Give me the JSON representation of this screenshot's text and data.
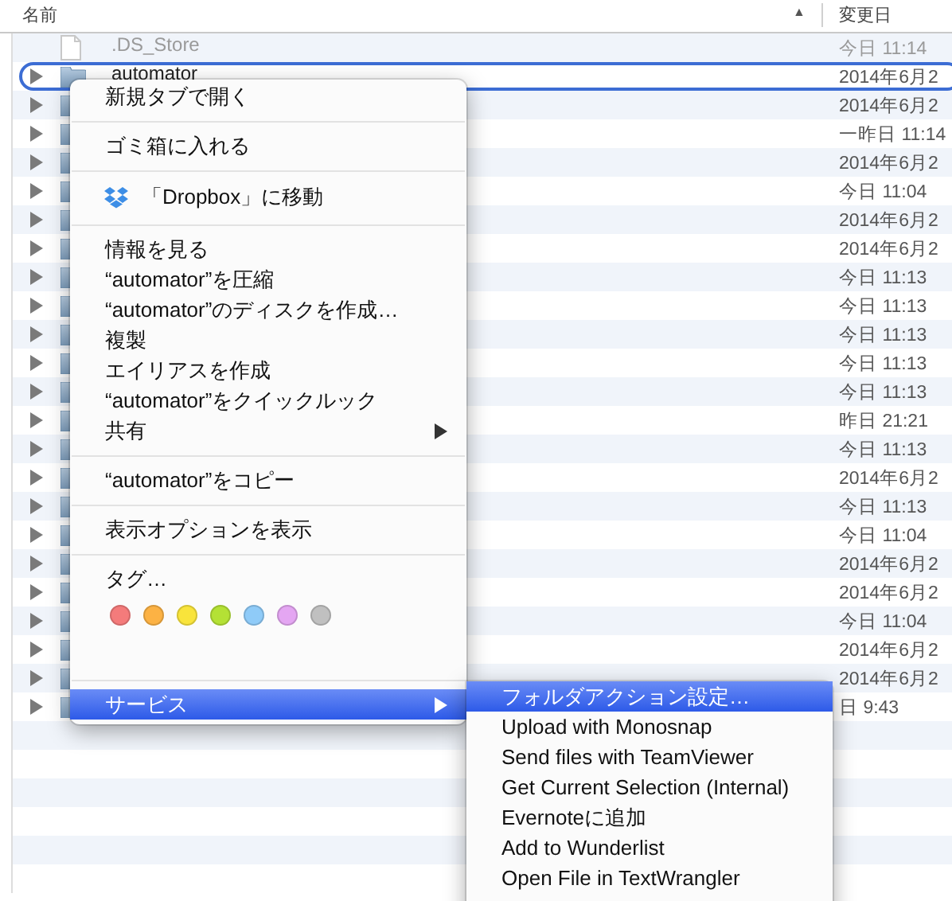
{
  "columns": {
    "name": "名前",
    "sort_arrow": "▲",
    "date": "変更日"
  },
  "rows": [
    {
      "kind": "file",
      "name": ".DS_Store",
      "date": "今日 11:14",
      "selected": false
    },
    {
      "kind": "folder",
      "name": "automator",
      "date": "2014年6月2",
      "selected": true
    },
    {
      "kind": "folder",
      "date": "2014年6月2",
      "selected": false
    },
    {
      "kind": "folder",
      "date": "一昨日 11:14",
      "selected": false
    },
    {
      "kind": "folder",
      "date": "2014年6月2",
      "selected": false
    },
    {
      "kind": "folder",
      "date": "今日 11:04",
      "selected": false
    },
    {
      "kind": "folder",
      "date": "2014年6月2",
      "selected": false
    },
    {
      "kind": "folder",
      "date": "2014年6月2",
      "selected": false
    },
    {
      "kind": "folder",
      "date": "今日 11:13",
      "selected": false
    },
    {
      "kind": "folder",
      "date": "今日 11:13",
      "selected": false
    },
    {
      "kind": "folder",
      "date": "今日 11:13",
      "selected": false
    },
    {
      "kind": "folder",
      "date": "今日 11:13",
      "selected": false
    },
    {
      "kind": "folder",
      "date": "今日 11:13",
      "selected": false
    },
    {
      "kind": "folder",
      "date": "昨日 21:21",
      "selected": false
    },
    {
      "kind": "folder",
      "date": "今日 11:13",
      "selected": false
    },
    {
      "kind": "folder",
      "date": "2014年6月2",
      "selected": false
    },
    {
      "kind": "folder",
      "date": "今日 11:13",
      "selected": false
    },
    {
      "kind": "folder",
      "date": "今日 11:04",
      "selected": false
    },
    {
      "kind": "folder",
      "date": "2014年6月2",
      "selected": false
    },
    {
      "kind": "folder",
      "date": "2014年6月2",
      "selected": false
    },
    {
      "kind": "folder",
      "date": "今日 11:04",
      "selected": false
    },
    {
      "kind": "folder",
      "date": "2014年6月2",
      "selected": false
    },
    {
      "kind": "folder",
      "date": "2014年6月2",
      "selected": false
    },
    {
      "kind": "folder",
      "date": "日 9:43",
      "selected": false
    },
    {
      "kind": "empty",
      "selected": false
    },
    {
      "kind": "empty",
      "selected": false
    },
    {
      "kind": "empty",
      "selected": false
    },
    {
      "kind": "empty",
      "selected": false
    },
    {
      "kind": "empty",
      "selected": false
    },
    {
      "kind": "empty",
      "selected": false
    }
  ],
  "context_menu": {
    "sections": [
      [
        {
          "kind": "item",
          "label": "新規タブで開く",
          "submenu": false,
          "selected": false
        }
      ],
      [
        {
          "kind": "item",
          "label": "ゴミ箱に入れる",
          "submenu": false,
          "selected": false
        }
      ],
      [
        {
          "kind": "dropbox",
          "label": "「Dropbox」に移動",
          "submenu": false,
          "selected": false
        }
      ],
      [
        {
          "kind": "item",
          "label": "情報を見る",
          "submenu": false,
          "selected": false
        },
        {
          "kind": "item",
          "label": "“automator”を圧縮",
          "submenu": false,
          "selected": false
        },
        {
          "kind": "item",
          "label": "“automator”のディスクを作成…",
          "submenu": false,
          "selected": false
        },
        {
          "kind": "item",
          "label": "複製",
          "submenu": false,
          "selected": false
        },
        {
          "kind": "item",
          "label": "エイリアスを作成",
          "submenu": false,
          "selected": false
        },
        {
          "kind": "item",
          "label": "“automator”をクイックルック",
          "submenu": false,
          "selected": false
        },
        {
          "kind": "item",
          "label": "共有",
          "submenu": true,
          "selected": false
        }
      ],
      [
        {
          "kind": "item",
          "label": "“automator”をコピー",
          "submenu": false,
          "selected": false
        }
      ],
      [
        {
          "kind": "item",
          "label": "表示オプションを表示",
          "submenu": false,
          "selected": false
        }
      ],
      [
        {
          "kind": "item",
          "label": "タグ…",
          "submenu": false,
          "selected": false
        },
        {
          "kind": "tags",
          "colors": [
            {
              "color": "#f47b7b"
            },
            {
              "color": "#fcb244"
            },
            {
              "color": "#f9e43b"
            },
            {
              "color": "#b4e135"
            },
            {
              "color": "#8fcbf8"
            },
            {
              "color": "#e4a6f2"
            },
            {
              "color": "#c0c0c0"
            }
          ]
        }
      ],
      [
        {
          "kind": "item",
          "label": "サービス",
          "submenu": true,
          "selected": true
        }
      ]
    ]
  },
  "services_menu": {
    "items": [
      {
        "label": "フォルダアクション設定…",
        "selected": true
      },
      {
        "label": "Upload with Monosnap",
        "selected": false
      },
      {
        "label": "Send files with TeamViewer",
        "selected": false
      },
      {
        "label": "Get Current Selection (Internal)",
        "selected": false
      },
      {
        "label": "Evernoteに追加",
        "selected": false
      },
      {
        "label": "Add to Wunderlist",
        "selected": false
      },
      {
        "label": "Open File in TextWrangler",
        "selected": false
      }
    ]
  }
}
